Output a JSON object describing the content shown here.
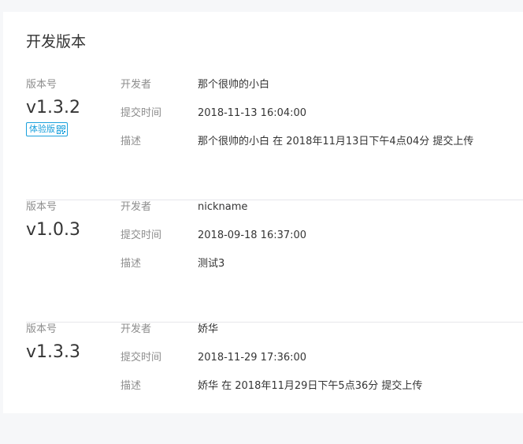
{
  "panel": {
    "title": "开发版本"
  },
  "versions": [
    {
      "version_label": "版本号",
      "version_number": "v1.3.2",
      "tag": "体验版",
      "tag_icon": "qr-code-icon",
      "developer_label": "开发者",
      "developer": "那个很帅的小白",
      "time_label": "提交时间",
      "time": "2018-11-13 16:04:00",
      "desc_label": "描述",
      "desc": "那个很帅的小白 在 2018年11月13日下午4点04分 提交上传"
    },
    {
      "version_label": "版本号",
      "version_number": "v1.0.3",
      "developer_label": "开发者",
      "developer": "nickname",
      "time_label": "提交时间",
      "time": "2018-09-18 16:37:00",
      "desc_label": "描述",
      "desc": "测试3"
    },
    {
      "version_label": "版本号",
      "version_number": "v1.3.3",
      "developer_label": "开发者",
      "developer": "娇华",
      "time_label": "提交时间",
      "time": "2018-11-29 17:36:00",
      "desc_label": "描述",
      "desc": "娇华 在 2018年11月29日下午5点36分 提交上传"
    }
  ],
  "colors": {
    "background": "#f6f7f9",
    "panel": "#ffffff",
    "label": "#8d8d8d",
    "text": "#353535",
    "tag_accent": "#1aa0dc",
    "divider": "#e7e7eb"
  }
}
